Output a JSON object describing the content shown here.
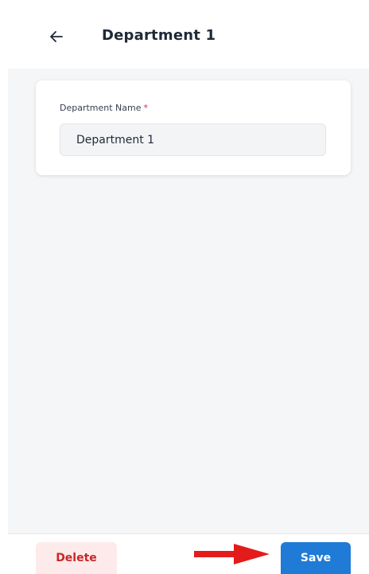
{
  "header": {
    "back_icon": "arrow-left-icon",
    "title": "Department 1"
  },
  "form": {
    "department_name_label": "Department Name",
    "required_marker": "*",
    "department_name_value": "Department 1"
  },
  "footer": {
    "delete_label": "Delete",
    "save_label": "Save"
  },
  "colors": {
    "primary": "#1f7bd6",
    "danger": "#c62828",
    "danger_bg": "#fdeaea",
    "required": "#e11d48",
    "annotation_arrow": "#e31b1b"
  },
  "annotation": {
    "arrow_icon": "red-arrow-right-icon"
  }
}
